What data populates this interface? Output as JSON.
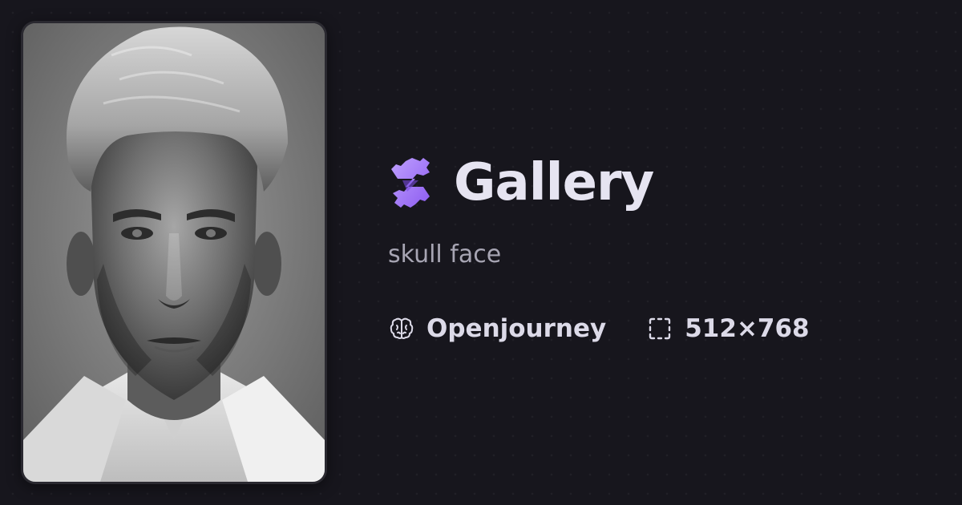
{
  "brand": {
    "title": "Gallery",
    "logo_icon": "gear-logo-icon",
    "logo_color": "#a77cf6"
  },
  "prompt": {
    "text": "skull face"
  },
  "meta": {
    "model": {
      "icon": "brain-icon",
      "label": "Openjourney"
    },
    "dimensions": {
      "icon": "selection-frame-icon",
      "label": "512×768"
    }
  },
  "image": {
    "description_icon": "generated-portrait-image"
  },
  "colors": {
    "background": "#17161d",
    "title": "#e6e4f1",
    "muted_text": "#a7a5b3",
    "accent": "#a77cf6"
  }
}
